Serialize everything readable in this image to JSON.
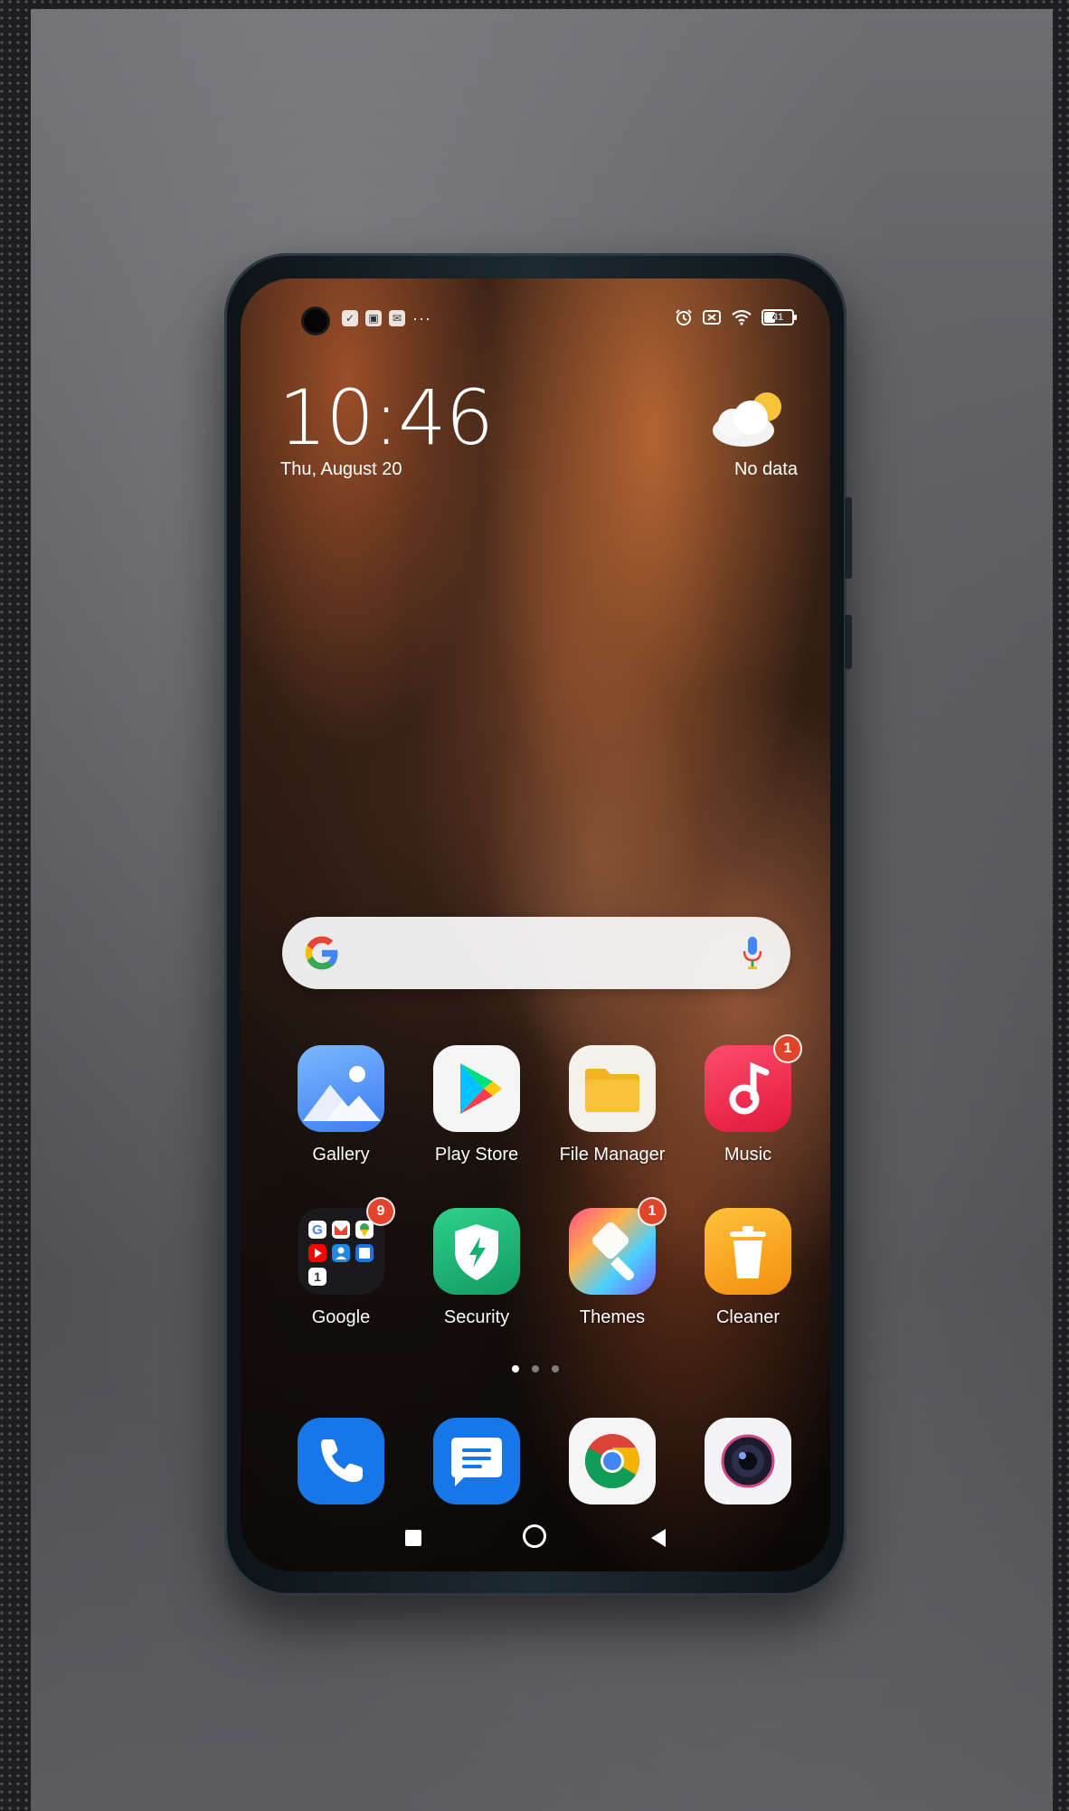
{
  "status_bar": {
    "overflow": "···",
    "battery": "41"
  },
  "lock_widget": {
    "time": "10:46",
    "date": "Thu, August 20",
    "weather": "No data"
  },
  "apps": [
    {
      "label": "Gallery",
      "badge": ""
    },
    {
      "label": "Play Store",
      "badge": ""
    },
    {
      "label": "File Manager",
      "badge": ""
    },
    {
      "label": "Music",
      "badge": "1"
    },
    {
      "label": "Google",
      "badge": "9"
    },
    {
      "label": "Security",
      "badge": ""
    },
    {
      "label": "Themes",
      "badge": "1"
    },
    {
      "label": "Cleaner",
      "badge": ""
    }
  ],
  "dock": [
    "phone-icon",
    "messages-icon",
    "chrome-icon",
    "camera-icon"
  ],
  "colors": {
    "badge": "#e0452b",
    "security": "#1fb27a",
    "cleaner": "#f4a81e",
    "dock_blue": "#1877e8"
  }
}
